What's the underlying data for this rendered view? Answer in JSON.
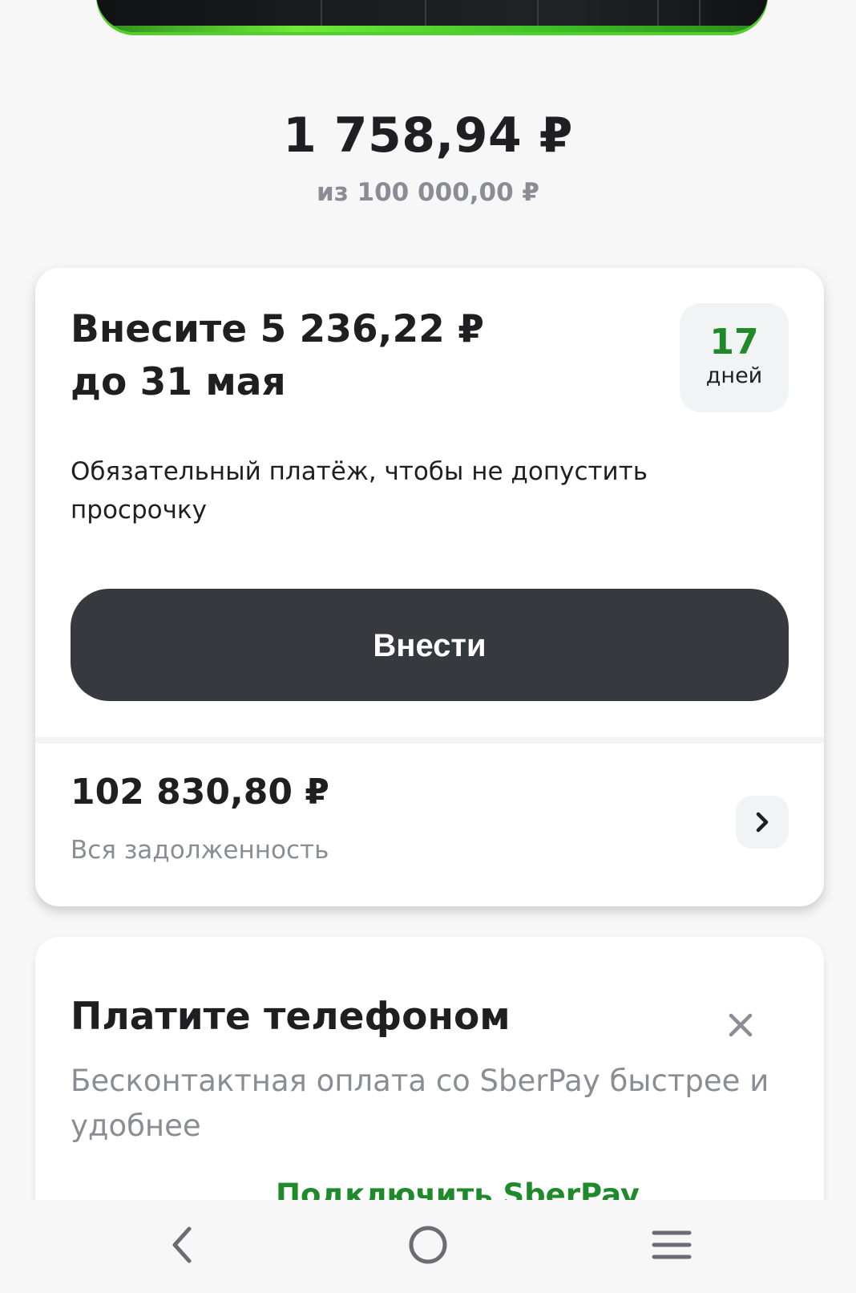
{
  "balance": {
    "available": "1 758,94 ₽",
    "limit": "из 100 000,00 ₽"
  },
  "payment": {
    "title_line1": "Внесите 5 236,22 ₽",
    "title_line2": "до 31 мая",
    "days_count": "17",
    "days_label": "дней",
    "description": "Обязательный платёж, чтобы не допустить просрочку",
    "button_label": "Внести"
  },
  "debt": {
    "amount": "102 830,80 ₽",
    "label": "Вся задолженность"
  },
  "promo": {
    "title": "Платите телефоном",
    "description": "Бесконтактная оплата со SberPay быстрее и удобнее",
    "link_label": "Подключить SberPay"
  },
  "colors": {
    "accent_green": "#1f8a2a",
    "button_dark": "#36393d",
    "muted_text": "#8a8d93"
  },
  "icons": {
    "chevron": "chevron-right-icon",
    "close": "close-icon",
    "nav_back": "back-icon",
    "nav_home": "home-icon",
    "nav_menu": "menu-icon"
  }
}
